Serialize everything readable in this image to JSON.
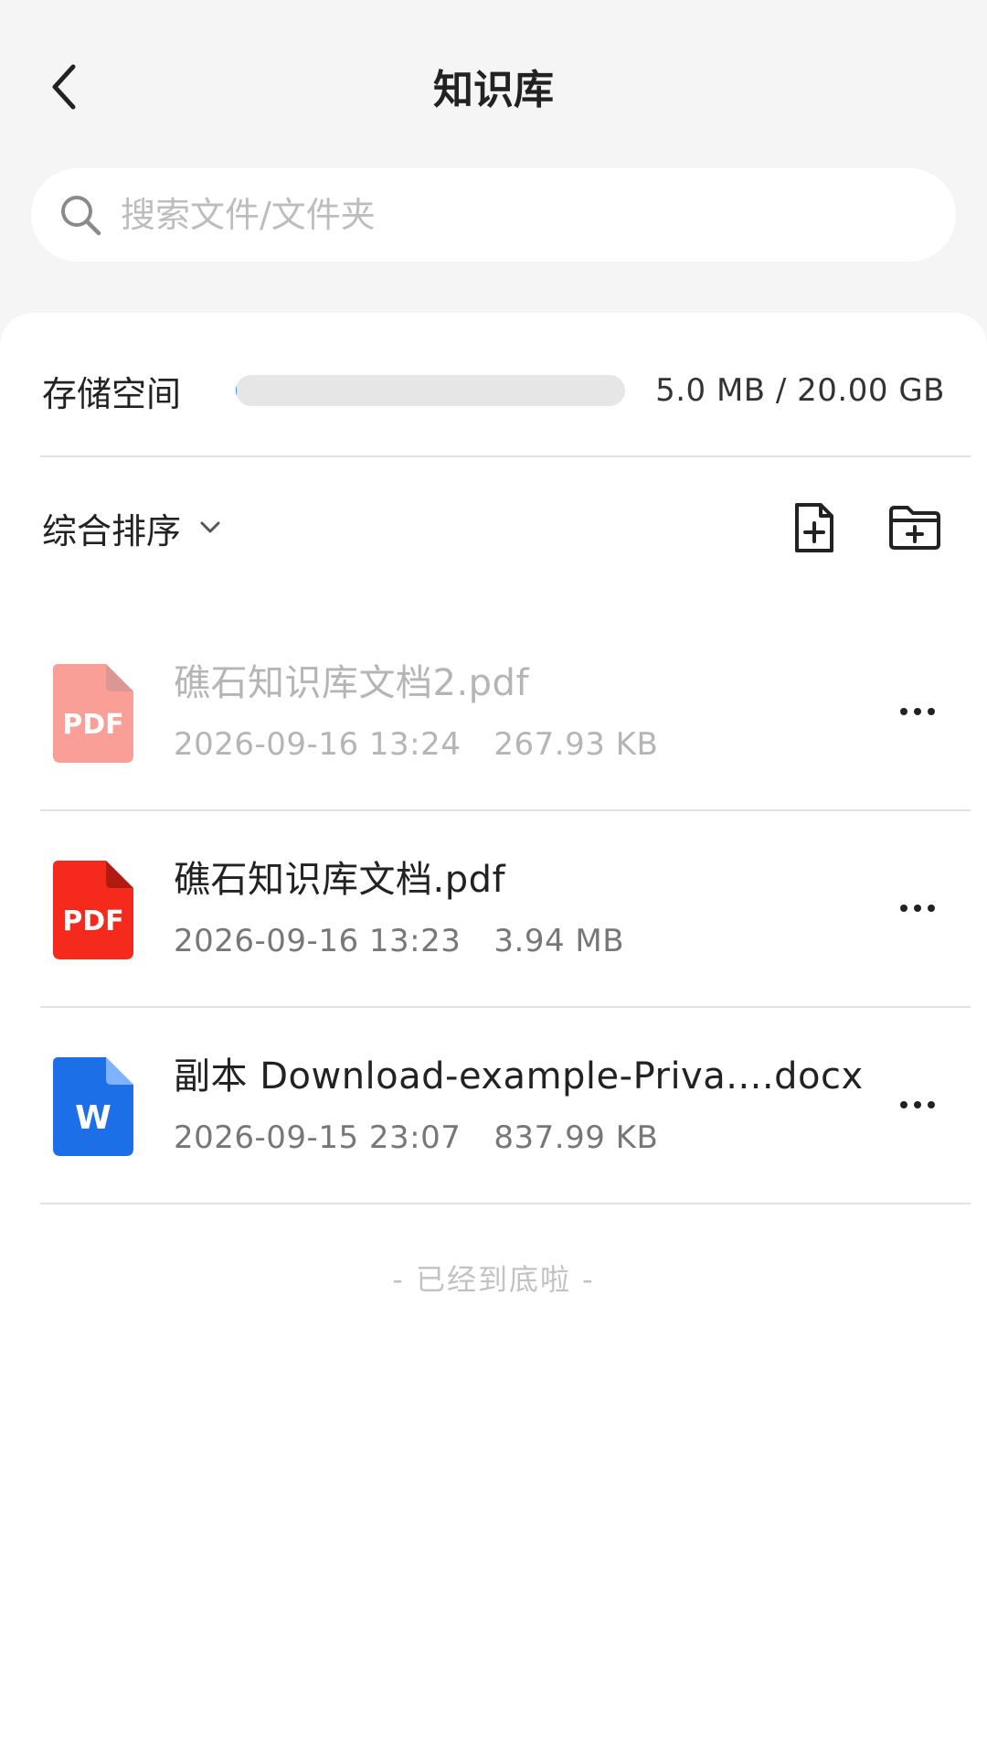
{
  "header": {
    "title": "知识库"
  },
  "search": {
    "placeholder": "搜索文件/文件夹"
  },
  "storage": {
    "label": "存储空间",
    "value_text": "5.0 MB / 20.00 GB",
    "used_fraction": 0.00024
  },
  "sort": {
    "label": "综合排序"
  },
  "files": [
    {
      "name": "礁石知识库文档2.pdf",
      "date": "2026-09-16 13:24",
      "size": "267.93 KB",
      "type": "pdf",
      "icon_text": "PDF",
      "dimmed": true
    },
    {
      "name": "礁石知识库文档.pdf",
      "date": "2026-09-16 13:23",
      "size": "3.94 MB",
      "type": "pdf",
      "icon_text": "PDF",
      "dimmed": false
    },
    {
      "name": "副本 Download-example-Priva....docx",
      "date": "2026-09-15 23:07",
      "size": "837.99 KB",
      "type": "docx",
      "icon_text": "W",
      "dimmed": false
    }
  ],
  "footer": {
    "end_text": "- 已经到底啦 -"
  },
  "colors": {
    "pdf": "#f5291c",
    "docx": "#1d6fe8",
    "background": "#f5f5f5"
  },
  "icons": [
    "back-arrow-icon",
    "search-icon",
    "chevron-down-icon",
    "add-file-icon",
    "add-folder-icon",
    "more-dots-icon",
    "pdf-file-icon",
    "word-file-icon"
  ]
}
